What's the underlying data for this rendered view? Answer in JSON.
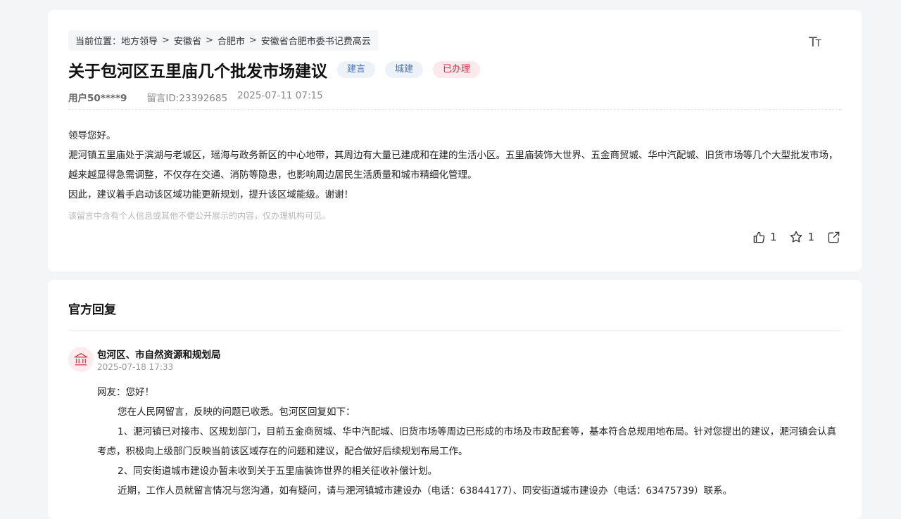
{
  "breadcrumb": {
    "prefix": "当前位置：",
    "items": [
      "地方领导",
      "安徽省",
      "合肥市",
      "安徽省合肥市委书记费高云"
    ],
    "separator": ">"
  },
  "font_toggle": {
    "big": "T",
    "small": "T"
  },
  "message": {
    "title": "关于包河区五里庙几个批发市场建议",
    "tags": [
      {
        "label": "建言",
        "color": "#4873b0"
      },
      {
        "label": "城建",
        "color": "#4873b0"
      },
      {
        "label": "已办理",
        "color": "#c92e3a"
      }
    ],
    "user": "用户50****9",
    "message_id": "留言ID:23392685",
    "time": "2025-07-11 07:15",
    "paragraphs": [
      "领导您好。",
      "淝河镇五里庙处于滨湖与老城区，瑶海与政务新区的中心地带，其周边有大量已建成和在建的生活小区。五里庙装饰大世界、五金商贸城、华中汽配城、旧货市场等几个大型批发市场，越来越显得急需调整，不仅存在交通、消防等隐患，也影响周边居民生活质量和城市精细化管理。",
      "因此，建议着手启动该区域功能更新规划，提升该区域能级。谢谢！"
    ],
    "privacy_note": "该留言中含有个人信息或其他不便公开展示的内容，仅办理机构可见。",
    "actions": {
      "like_count": "1",
      "fav_count": "1"
    }
  },
  "reply": {
    "section_title": "官方回复",
    "org_name": "包河区、市自然资源和规划局",
    "time": "2025-07-18 17:33",
    "greeting": "网友：您好！",
    "paragraphs": [
      "您在人民网留言，反映的问题已收悉。包河区回复如下：",
      "1、淝河镇已对接市、区规划部门，目前五金商贸城、华中汽配城、旧货市场等周边已形成的市场及市政配套等，基本符合总规用地布局。针对您提出的建议，淝河镇会认真考虑，积极向上级部门反映当前该区域存在的问题和建议，配合做好后续规划布局工作。",
      "2、同安街道城市建设办暂未收到关于五里庙装饰世界的相关征收补偿计划。",
      "近期，工作人员就留言情况与您沟通，如有疑问，请与淝河镇城市建设办（电话：63844177）、同安街道城市建设办（电话：63475739）联系。"
    ]
  },
  "colors": {
    "page_bg": "#f4f5f7",
    "tag_blue": "#4873b0",
    "tag_red": "#c92e3a"
  }
}
